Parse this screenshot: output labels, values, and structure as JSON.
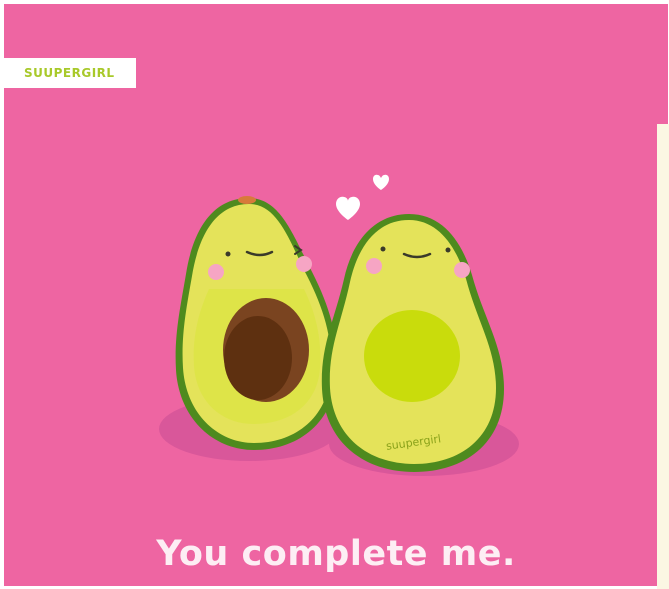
{
  "brand": {
    "label": "SUUPERGIRL"
  },
  "caption": {
    "text": "You complete me."
  },
  "avocado_right": {
    "signature": "suupergirl"
  },
  "icons": {
    "heart_large": "heart-icon",
    "heart_small": "heart-icon"
  },
  "colors": {
    "background": "#ee65a2",
    "brand_text": "#a8c92a",
    "avocado_skin": "#4e8a1e",
    "avocado_flesh": "#e4e35a",
    "pit": "#7a4420",
    "pit_hole": "#c9dc0c",
    "cheek": "#f6a5c4",
    "caption": "#fdeef4"
  }
}
